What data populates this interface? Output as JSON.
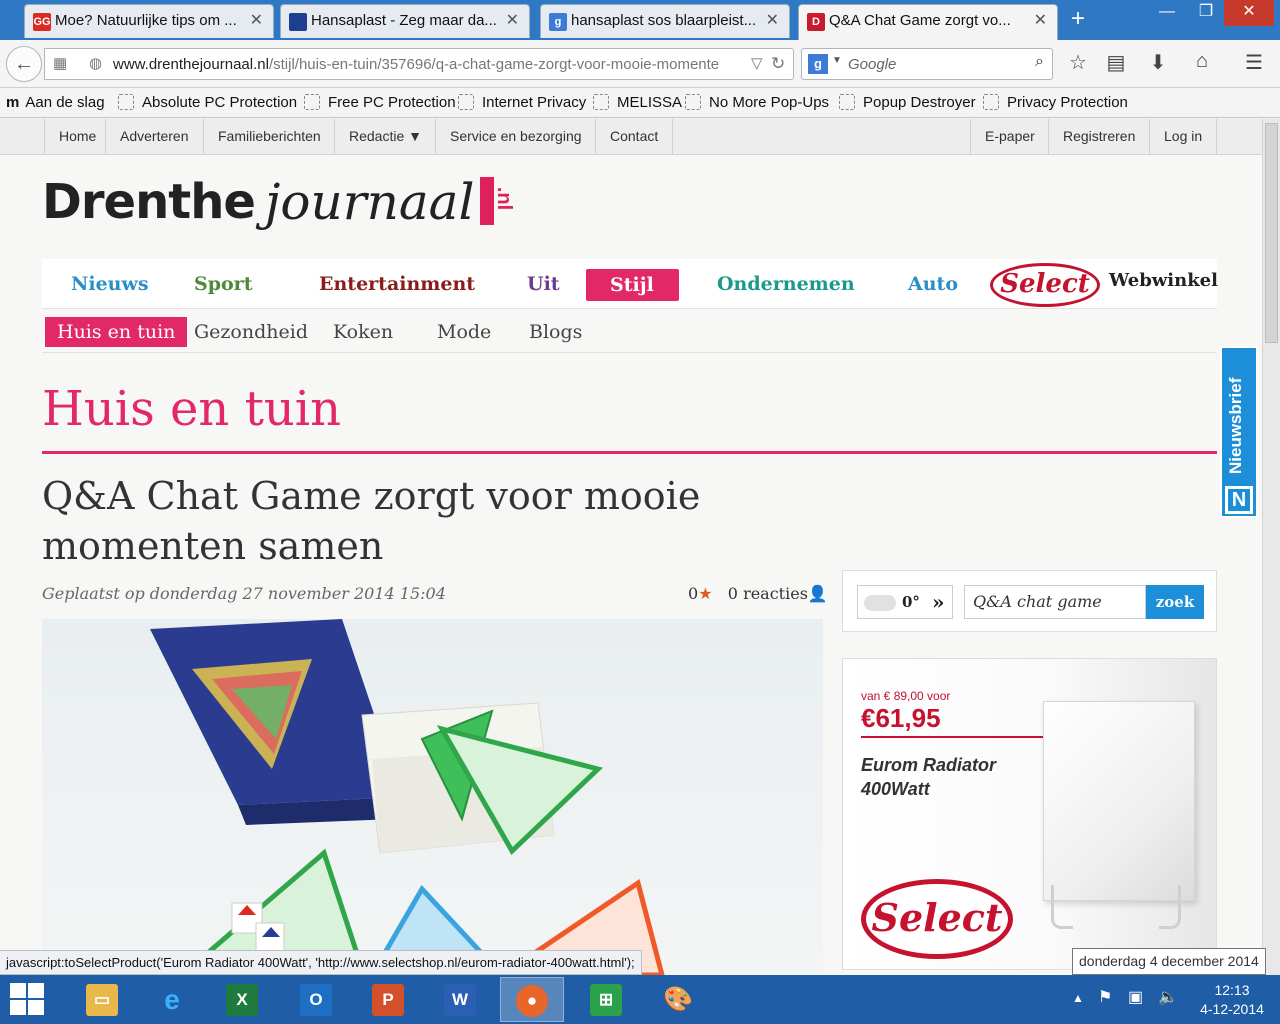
{
  "browser": {
    "tabs": [
      {
        "title": "Moe? Natuurlijke tips om ...",
        "favicon_text": "GG",
        "favicon_color": "#d92b20"
      },
      {
        "title": "Hansaplast - Zeg maar da...",
        "favicon_text": "",
        "favicon_color": "#1d3f8f"
      },
      {
        "title": "hansaplast sos blaarpleist...",
        "favicon_text": "g",
        "favicon_color": "#3d7bd8"
      },
      {
        "title": "Q&A Chat Game zorgt vo...",
        "favicon_text": "D",
        "favicon_color": "#c91b2e"
      }
    ],
    "url_domain": "www.drenthejournaal.nl",
    "url_path": "/stijl/huis-en-tuin/357696/q-a-chat-game-zorgt-voor-mooie-momente",
    "search_placeholder": "Google",
    "bookmarks_menu": "Aan de slag",
    "bookmarks": [
      "Absolute PC Protection",
      "Free PC Protection",
      "Internet Privacy",
      "MELISSA",
      "No More Pop-Ups",
      "Popup Destroyer",
      "Privacy Protection"
    ]
  },
  "site": {
    "topnav_left": [
      "Home",
      "Adverteren",
      "Familieberichten",
      "Redactie ▼",
      "Service en bezorging",
      "Contact"
    ],
    "topnav_right": [
      "E-paper",
      "Registreren",
      "Log in"
    ],
    "logo_word1": "Drenthe",
    "logo_word2": "journaal",
    "logo_suffix": ".nl",
    "mainnav": [
      {
        "label": "Nieuws",
        "color": "#2a8fc7"
      },
      {
        "label": "Sport",
        "color": "#4d8a3a"
      },
      {
        "label": "Entertainment",
        "color": "#8b1c1c"
      },
      {
        "label": "Uit",
        "color": "#6e3b8f"
      },
      {
        "label": "Stijl",
        "color": "#ffffff"
      },
      {
        "label": "Ondernemen",
        "color": "#1a9a8a"
      },
      {
        "label": "Auto",
        "color": "#2a8fc7"
      }
    ],
    "webshop_logo": "Select",
    "webshop_label": "Webwinkel",
    "subnav": [
      "Huis en tuin",
      "Gezondheid",
      "Koken",
      "Mode",
      "Blogs"
    ],
    "section_title": "Huis en tuin",
    "accent": "#e22866"
  },
  "article": {
    "title": "Q&A Chat Game zorgt voor mooie momenten samen",
    "posted": "Geplaatst op donderdag 27 november 2014 15:04",
    "rating": "0",
    "comments": "0 reacties"
  },
  "widget": {
    "temperature": "0°",
    "search_value": "Q&A chat game",
    "search_button": "zoek"
  },
  "newsletter": {
    "label": "Nieuwsbrief",
    "letter": "N"
  },
  "ad": {
    "was_price": "van € 89,00 voor",
    "price": "€61,95",
    "product": "Eurom Radiator 400Watt",
    "brand": "Select"
  },
  "status": {
    "link": "javascript:toSelectProduct('Eurom Radiator 400Watt', 'http://www.selectshop.nl/eurom-radiator-400watt.html');",
    "date_tooltip": "donderdag 4 december 2014"
  },
  "taskbar": {
    "time": "12:13",
    "date": "4-12-2014"
  }
}
